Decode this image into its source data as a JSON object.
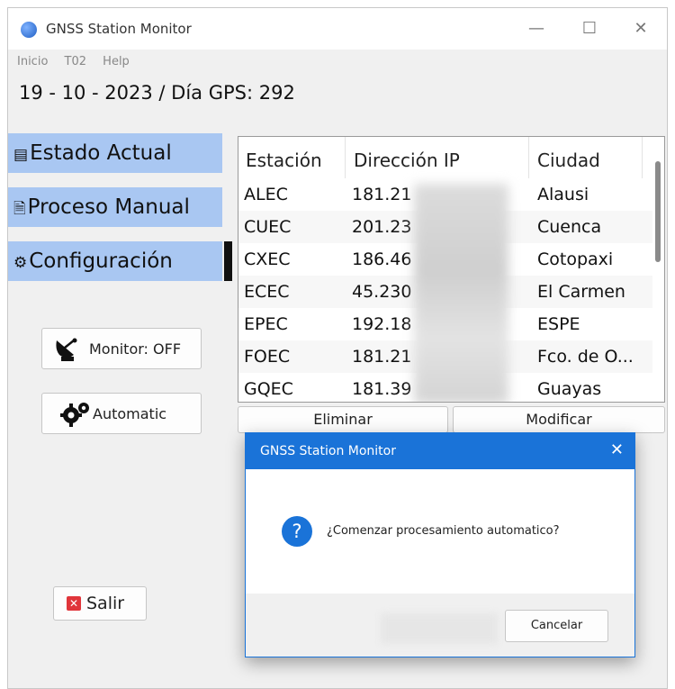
{
  "window": {
    "title": "GNSS Station Monitor",
    "minimize": "—",
    "maximize": "☐",
    "close": "✕"
  },
  "menu": [
    "Inicio",
    "T02",
    "Help"
  ],
  "date_line": "19 - 10 - 2023 / Día GPS: 292",
  "nav": {
    "estado": "Estado Actual",
    "proceso": "Proceso Manual",
    "config": "Configuración",
    "icons": {
      "estado": "▤",
      "proceso": "🗎",
      "config": "⚙"
    }
  },
  "buttons": {
    "monitor": "Monitor: OFF",
    "automatic": "Automatic",
    "salir": "Salir"
  },
  "table": {
    "headers": [
      "Estación",
      "Dirección IP",
      "Ciudad"
    ],
    "rows": [
      [
        "ALEC",
        "181.21",
        "Alausi"
      ],
      [
        "CUEC",
        "201.23",
        "Cuenca"
      ],
      [
        "CXEC",
        "186.46",
        "Cotopaxi"
      ],
      [
        "ECEC",
        "45.230",
        "El Carmen"
      ],
      [
        "EPEC",
        "192.18",
        "ESPE"
      ],
      [
        "FOEC",
        "181.21",
        "Fco. de O..."
      ],
      [
        "GQEC",
        "181.39",
        "Guayas"
      ]
    ]
  },
  "actions": {
    "eliminar": "Eliminar",
    "modificar": "Modificar"
  },
  "dialog": {
    "title": "GNSS Station Monitor",
    "close": "✕",
    "icon": "?",
    "message": "¿Comenzar procesamiento automatico?",
    "cancel": "Cancelar"
  },
  "colors": {
    "nav_bg": "#a9c7f2",
    "accent": "#1a73d8"
  }
}
